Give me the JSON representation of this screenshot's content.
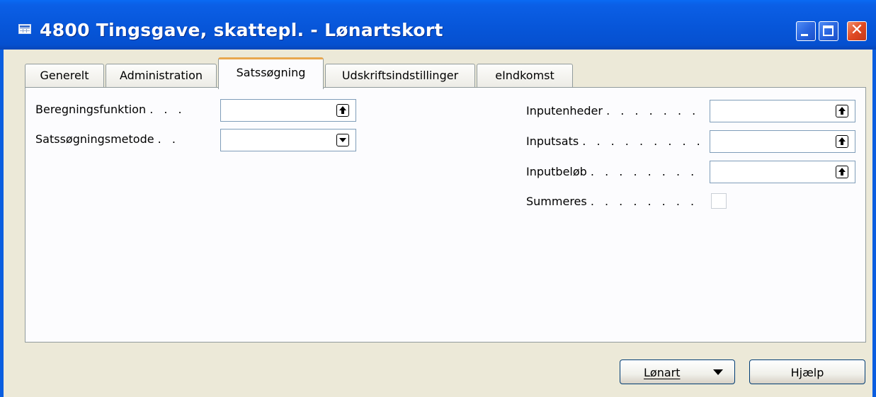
{
  "window": {
    "title": "4800 Tingsgave, skattepl. - Lønartskort",
    "controls": {
      "minimize": "",
      "maximize": "",
      "close": "✕"
    }
  },
  "tabs": [
    {
      "label": "Generelt"
    },
    {
      "label": "Administration"
    },
    {
      "label": "Satssøgning",
      "active": true
    },
    {
      "label": "Udskriftsindstillinger"
    },
    {
      "label": "eIndkomst"
    }
  ],
  "left_fields": [
    {
      "label": "Beregningsfunktion",
      "dots": ". . .",
      "value": "",
      "button_icon": "lookup-up-arrow-icon"
    },
    {
      "label": "Satssøgningsmetode",
      "dots": ". .",
      "value": "",
      "button_icon": "dropdown-arrow-icon"
    }
  ],
  "right_fields": [
    {
      "label": "Inputenheder",
      "dots": ". . . . . . .",
      "value": "",
      "button_icon": "lookup-up-arrow-icon"
    },
    {
      "label": "Inputsats",
      "dots": ". . . . . . . . .",
      "value": "",
      "button_icon": "lookup-up-arrow-icon"
    },
    {
      "label": "Inputbeløb",
      "dots": ". . . . . . . .",
      "value": "",
      "button_icon": "lookup-up-arrow-icon"
    }
  ],
  "checkbox_field": {
    "label": "Summeres",
    "dots": ". . . . . . . .",
    "checked": false
  },
  "buttons": {
    "lonart": "Lønart",
    "hjaelp": "Hjælp"
  },
  "colors": {
    "titlebar": "#0550d0",
    "client_bg": "#ece9d8",
    "active_tab_highlight": "#e8a74e"
  }
}
